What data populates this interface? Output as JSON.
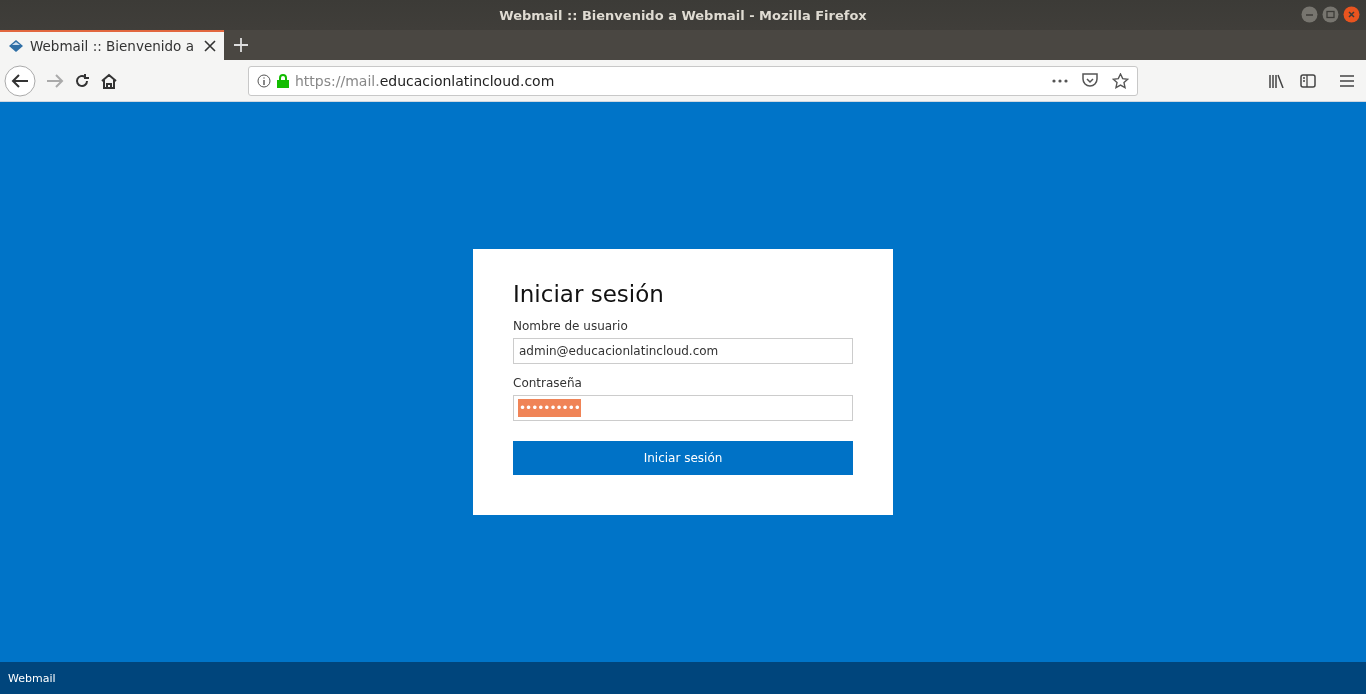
{
  "window": {
    "title": "Webmail :: Bienvenido a Webmail - Mozilla Firefox"
  },
  "tabs": [
    {
      "label": "Webmail :: Bienvenido a",
      "selected": true
    }
  ],
  "address_bar": {
    "url_dim": "https://mail.",
    "url_main": "educacionlatincloud.com"
  },
  "login": {
    "title": "Iniciar sesión",
    "fields": [
      {
        "label": "Nombre de usuario",
        "kind": "text",
        "value": "admin@educacionlatincloud.com",
        "selected": false
      },
      {
        "label": "Contraseña",
        "kind": "password",
        "value": "••••••••••",
        "selected": true
      }
    ],
    "button": "Iniciar sesión"
  },
  "footer": "Webmail"
}
